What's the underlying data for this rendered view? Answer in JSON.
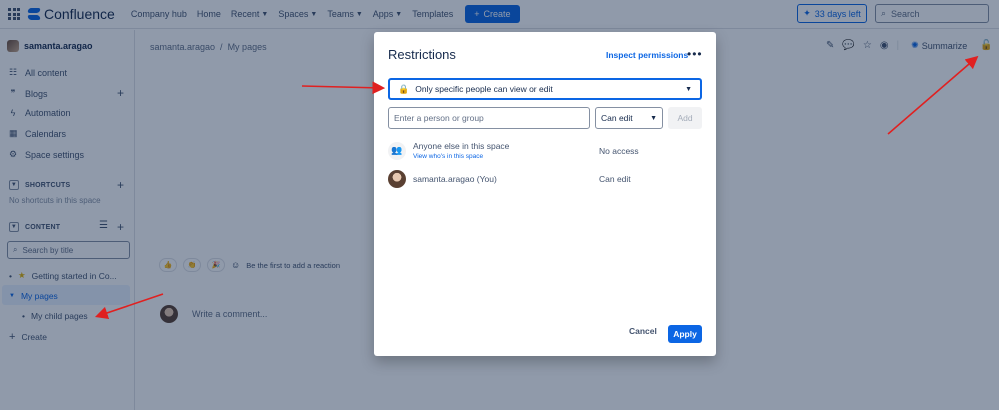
{
  "topnav": {
    "logo": "Confluence",
    "items": [
      {
        "label": "Company hub",
        "chevron": false
      },
      {
        "label": "Home",
        "chevron": false
      },
      {
        "label": "Recent",
        "chevron": true
      },
      {
        "label": "Spaces",
        "chevron": true
      },
      {
        "label": "Teams",
        "chevron": true
      },
      {
        "label": "Apps",
        "chevron": true
      },
      {
        "label": "Templates",
        "chevron": false
      }
    ],
    "create_label": "Create",
    "trial_label": "33 days left",
    "search_placeholder": "Search"
  },
  "sidebar": {
    "space_name": "samanta.aragao",
    "items": [
      {
        "label": "All content",
        "icon": "list-icon"
      },
      {
        "label": "Blogs",
        "icon": "quote-icon"
      },
      {
        "label": "Automation",
        "icon": "lightning-icon"
      },
      {
        "label": "Calendars",
        "icon": "calendar-icon"
      },
      {
        "label": "Space settings",
        "icon": "gear-icon"
      }
    ],
    "shortcuts_heading": "SHORTCUTS",
    "shortcuts_empty": "No shortcuts in this space",
    "content_heading": "CONTENT",
    "search_placeholder": "Search by title",
    "tree": {
      "getting_started": "Getting started in Co...",
      "my_pages": "My pages",
      "my_child_pages": "My child pages",
      "create": "Create"
    }
  },
  "main": {
    "breadcrumb": [
      "samanta.aragao",
      "/",
      "My pages"
    ],
    "summarize_label": "Summarize",
    "reaction_text": "Be the first to add a reaction",
    "comment_placeholder": "Write a comment..."
  },
  "modal": {
    "title": "Restrictions",
    "inspect_label": "Inspect permissions",
    "restriction_value": "Only specific people can view or edit",
    "person_placeholder": "Enter a person or group",
    "permission_value": "Can edit",
    "add_label": "Add",
    "rows": [
      {
        "name": "Anyone else in this space",
        "link": "View who's in this space",
        "permission": "No access"
      },
      {
        "name": "samanta.aragao (You)",
        "permission": "Can edit"
      }
    ],
    "cancel_label": "Cancel",
    "apply_label": "Apply"
  },
  "colors": {
    "accent": "#0c66e4",
    "annotation_arrow": "#e02020",
    "lock": "#c9372c"
  }
}
